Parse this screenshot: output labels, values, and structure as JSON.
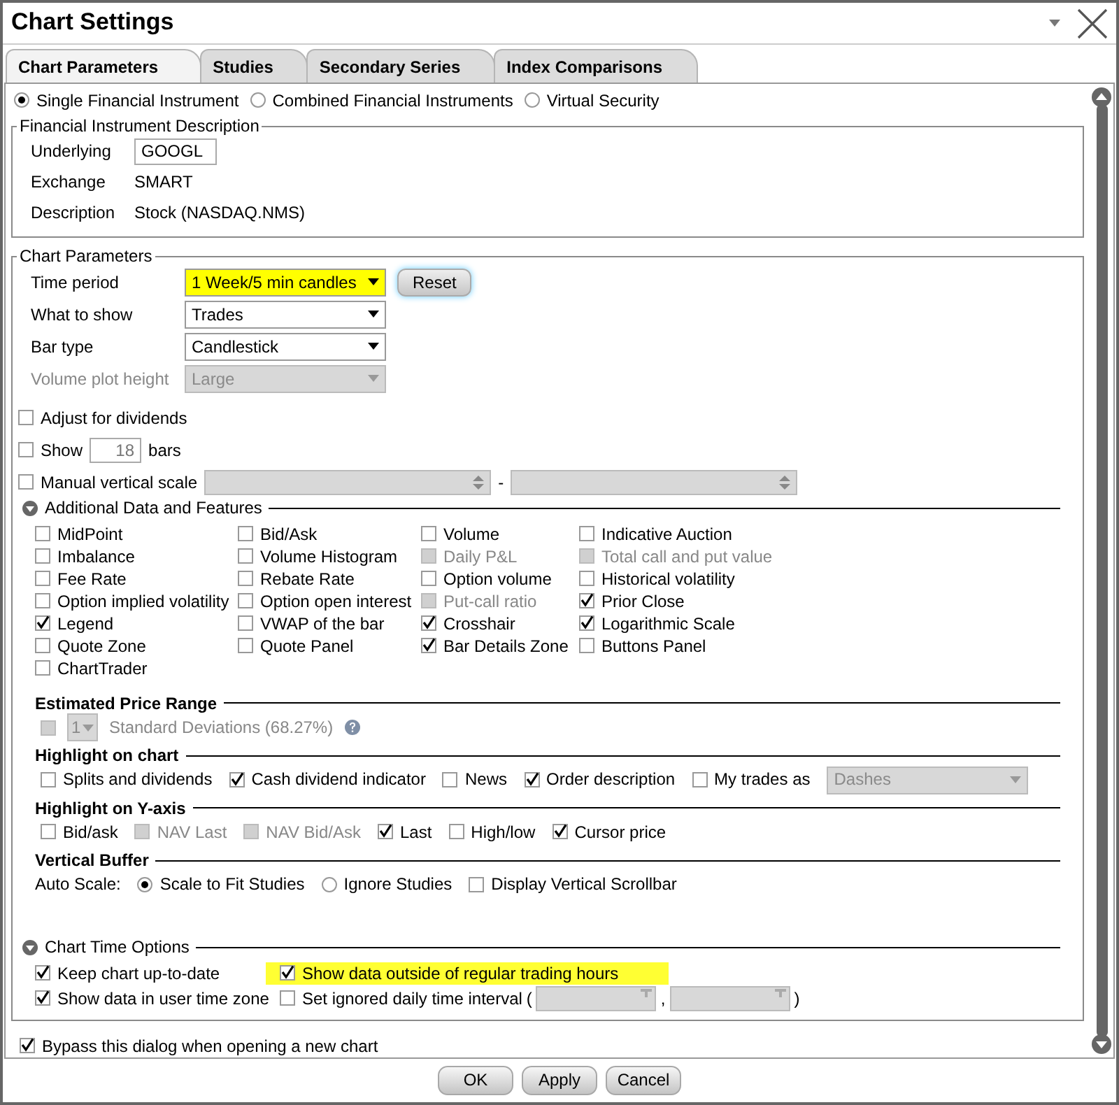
{
  "window": {
    "title": "Chart Settings"
  },
  "tabs": [
    {
      "label": "Chart Parameters",
      "selected": true
    },
    {
      "label": "Studies",
      "selected": false
    },
    {
      "label": "Secondary Series",
      "selected": false
    },
    {
      "label": "Index Comparisons",
      "selected": false
    }
  ],
  "instrument_types": [
    {
      "label": "Single Financial Instrument",
      "selected": true
    },
    {
      "label": "Combined Financial Instruments",
      "selected": false
    },
    {
      "label": "Virtual Security",
      "selected": false
    }
  ],
  "instrument_description": {
    "title": "Financial Instrument Description",
    "fields": [
      {
        "label": "Underlying",
        "value": "GOOGL",
        "kind": "input"
      },
      {
        "label": "Exchange",
        "value": "SMART",
        "kind": "text"
      },
      {
        "label": "Description",
        "value": "Stock (NASDAQ.NMS)",
        "kind": "text"
      }
    ]
  },
  "chart_parameters": {
    "title": "Chart Parameters",
    "reset_button": "Reset",
    "selects": [
      {
        "label": "Time period",
        "value": "1 Week/5 min candles",
        "highlighted": true,
        "disabled": false
      },
      {
        "label": "What to show",
        "value": "Trades",
        "highlighted": false,
        "disabled": false
      },
      {
        "label": "Bar type",
        "value": "Candlestick",
        "highlighted": false,
        "disabled": false
      },
      {
        "label": "Volume plot height",
        "value": "Large",
        "highlighted": false,
        "disabled": true
      }
    ],
    "lines": [
      {
        "items": [
          {
            "kind": "checkbox",
            "label": "Adjust for dividends",
            "checked": false,
            "disabled": false
          }
        ]
      },
      {
        "items": [
          {
            "kind": "checkbox",
            "label": "Show",
            "checked": false,
            "disabled": false
          },
          {
            "kind": "number",
            "value": "18"
          },
          {
            "kind": "text",
            "text": "bars",
            "disabled": false
          }
        ]
      },
      {
        "items": [
          {
            "kind": "checkbox",
            "label": "Manual vertical scale",
            "checked": false,
            "disabled": false
          },
          {
            "kind": "spinner",
            "disabled": true
          },
          {
            "kind": "text",
            "text": "-",
            "disabled": false
          },
          {
            "kind": "spinner",
            "disabled": true
          }
        ]
      }
    ],
    "additional": {
      "title": "Additional Data and Features",
      "expanded": true,
      "items": [
        {
          "label": "MidPoint",
          "checked": false,
          "disabled": false
        },
        {
          "label": "Bid/Ask",
          "checked": false,
          "disabled": false
        },
        {
          "label": "Volume",
          "checked": false,
          "disabled": false
        },
        {
          "label": "Indicative Auction",
          "checked": false,
          "disabled": false
        },
        {
          "label": "Imbalance",
          "checked": false,
          "disabled": false
        },
        {
          "label": "Volume Histogram",
          "checked": false,
          "disabled": false
        },
        {
          "label": "Daily P&L",
          "checked": false,
          "disabled": true
        },
        {
          "label": "Total call and put value",
          "checked": false,
          "disabled": true
        },
        {
          "label": "Fee Rate",
          "checked": false,
          "disabled": false
        },
        {
          "label": "Rebate Rate",
          "checked": false,
          "disabled": false
        },
        {
          "label": "Option volume",
          "checked": false,
          "disabled": false
        },
        {
          "label": "Historical volatility",
          "checked": false,
          "disabled": false
        },
        {
          "label": "Option implied volatility",
          "checked": false,
          "disabled": false
        },
        {
          "label": "Option open interest",
          "checked": false,
          "disabled": false
        },
        {
          "label": "Put-call ratio",
          "checked": false,
          "disabled": true
        },
        {
          "label": "Prior Close",
          "checked": true,
          "disabled": false
        },
        {
          "label": "Legend",
          "checked": true,
          "disabled": false
        },
        {
          "label": "VWAP of the bar",
          "checked": false,
          "disabled": false
        },
        {
          "label": "Crosshair",
          "checked": true,
          "disabled": false
        },
        {
          "label": "Logarithmic Scale",
          "checked": true,
          "disabled": false
        },
        {
          "label": "Quote Zone",
          "checked": false,
          "disabled": false
        },
        {
          "label": "Quote Panel",
          "checked": false,
          "disabled": false
        },
        {
          "label": "Bar Details Zone",
          "checked": true,
          "disabled": false
        },
        {
          "label": "Buttons Panel",
          "checked": false,
          "disabled": false
        },
        {
          "label": "ChartTrader",
          "checked": false,
          "disabled": false
        }
      ],
      "subsections": [
        {
          "title": "Estimated Price Range",
          "items": [
            {
              "kind": "checkbox",
              "checked": false,
              "disabled": true
            },
            {
              "kind": "select",
              "value": "1",
              "disabled": true
            },
            {
              "kind": "text",
              "text": "Standard Deviations (68.27%)",
              "disabled": true
            },
            {
              "kind": "help"
            }
          ]
        },
        {
          "title": "Highlight on chart",
          "items": [
            {
              "kind": "checkbox",
              "label": "Splits and dividends",
              "checked": false,
              "disabled": false
            },
            {
              "kind": "checkbox",
              "label": "Cash dividend indicator",
              "checked": true,
              "disabled": false
            },
            {
              "kind": "checkbox",
              "label": "News",
              "checked": false,
              "disabled": false
            },
            {
              "kind": "checkbox",
              "label": "Order description",
              "checked": true,
              "disabled": false
            },
            {
              "kind": "checkbox",
              "label": "My trades as",
              "checked": false,
              "disabled": false
            },
            {
              "kind": "select",
              "value": "Dashes",
              "disabled": true
            }
          ]
        },
        {
          "title": "Highlight on Y-axis",
          "items": [
            {
              "kind": "checkbox",
              "label": "Bid/ask",
              "checked": false,
              "disabled": false
            },
            {
              "kind": "checkbox",
              "label": "NAV Last",
              "checked": false,
              "disabled": true
            },
            {
              "kind": "checkbox",
              "label": "NAV Bid/Ask",
              "checked": false,
              "disabled": true
            },
            {
              "kind": "checkbox",
              "label": "Last",
              "checked": true,
              "disabled": false
            },
            {
              "kind": "checkbox",
              "label": "High/low",
              "checked": false,
              "disabled": false
            },
            {
              "kind": "checkbox",
              "label": "Cursor price",
              "checked": true,
              "disabled": false
            }
          ]
        },
        {
          "title": "Vertical Buffer",
          "items": [
            {
              "kind": "text",
              "text": "Auto Scale:",
              "disabled": false
            },
            {
              "kind": "radio",
              "label": "Scale to Fit Studies",
              "selected": true
            },
            {
              "kind": "radio",
              "label": "Ignore Studies",
              "selected": false
            },
            {
              "kind": "checkbox",
              "label": "Display Vertical Scrollbar",
              "checked": false,
              "disabled": false
            }
          ]
        }
      ]
    },
    "time_options": {
      "title": "Chart Time Options",
      "expanded": true,
      "lines": [
        {
          "items": [
            {
              "kind": "checkbox",
              "label": "Keep chart up-to-date",
              "checked": true,
              "disabled": false,
              "highlighted": false
            },
            {
              "kind": "checkbox",
              "label": "Show data outside of regular trading hours",
              "checked": true,
              "disabled": false,
              "highlighted": true
            }
          ]
        },
        {
          "items": [
            {
              "kind": "checkbox",
              "label": "Show data in user time zone",
              "checked": true,
              "disabled": false,
              "highlighted": false
            },
            {
              "kind": "checkbox",
              "label": "Set ignored daily time interval",
              "checked": false,
              "disabled": false,
              "highlighted": false
            },
            {
              "kind": "text",
              "text": "(",
              "disabled": false
            },
            {
              "kind": "time_field",
              "disabled": true
            },
            {
              "kind": "text",
              "text": ",",
              "disabled": false
            },
            {
              "kind": "time_field",
              "disabled": true
            },
            {
              "kind": "text",
              "text": ")",
              "disabled": false
            }
          ]
        }
      ]
    }
  },
  "bypass": {
    "label": "Bypass this dialog when opening a new chart",
    "checked": true
  },
  "buttons": [
    {
      "label": "OK"
    },
    {
      "label": "Apply"
    },
    {
      "label": "Cancel"
    }
  ]
}
